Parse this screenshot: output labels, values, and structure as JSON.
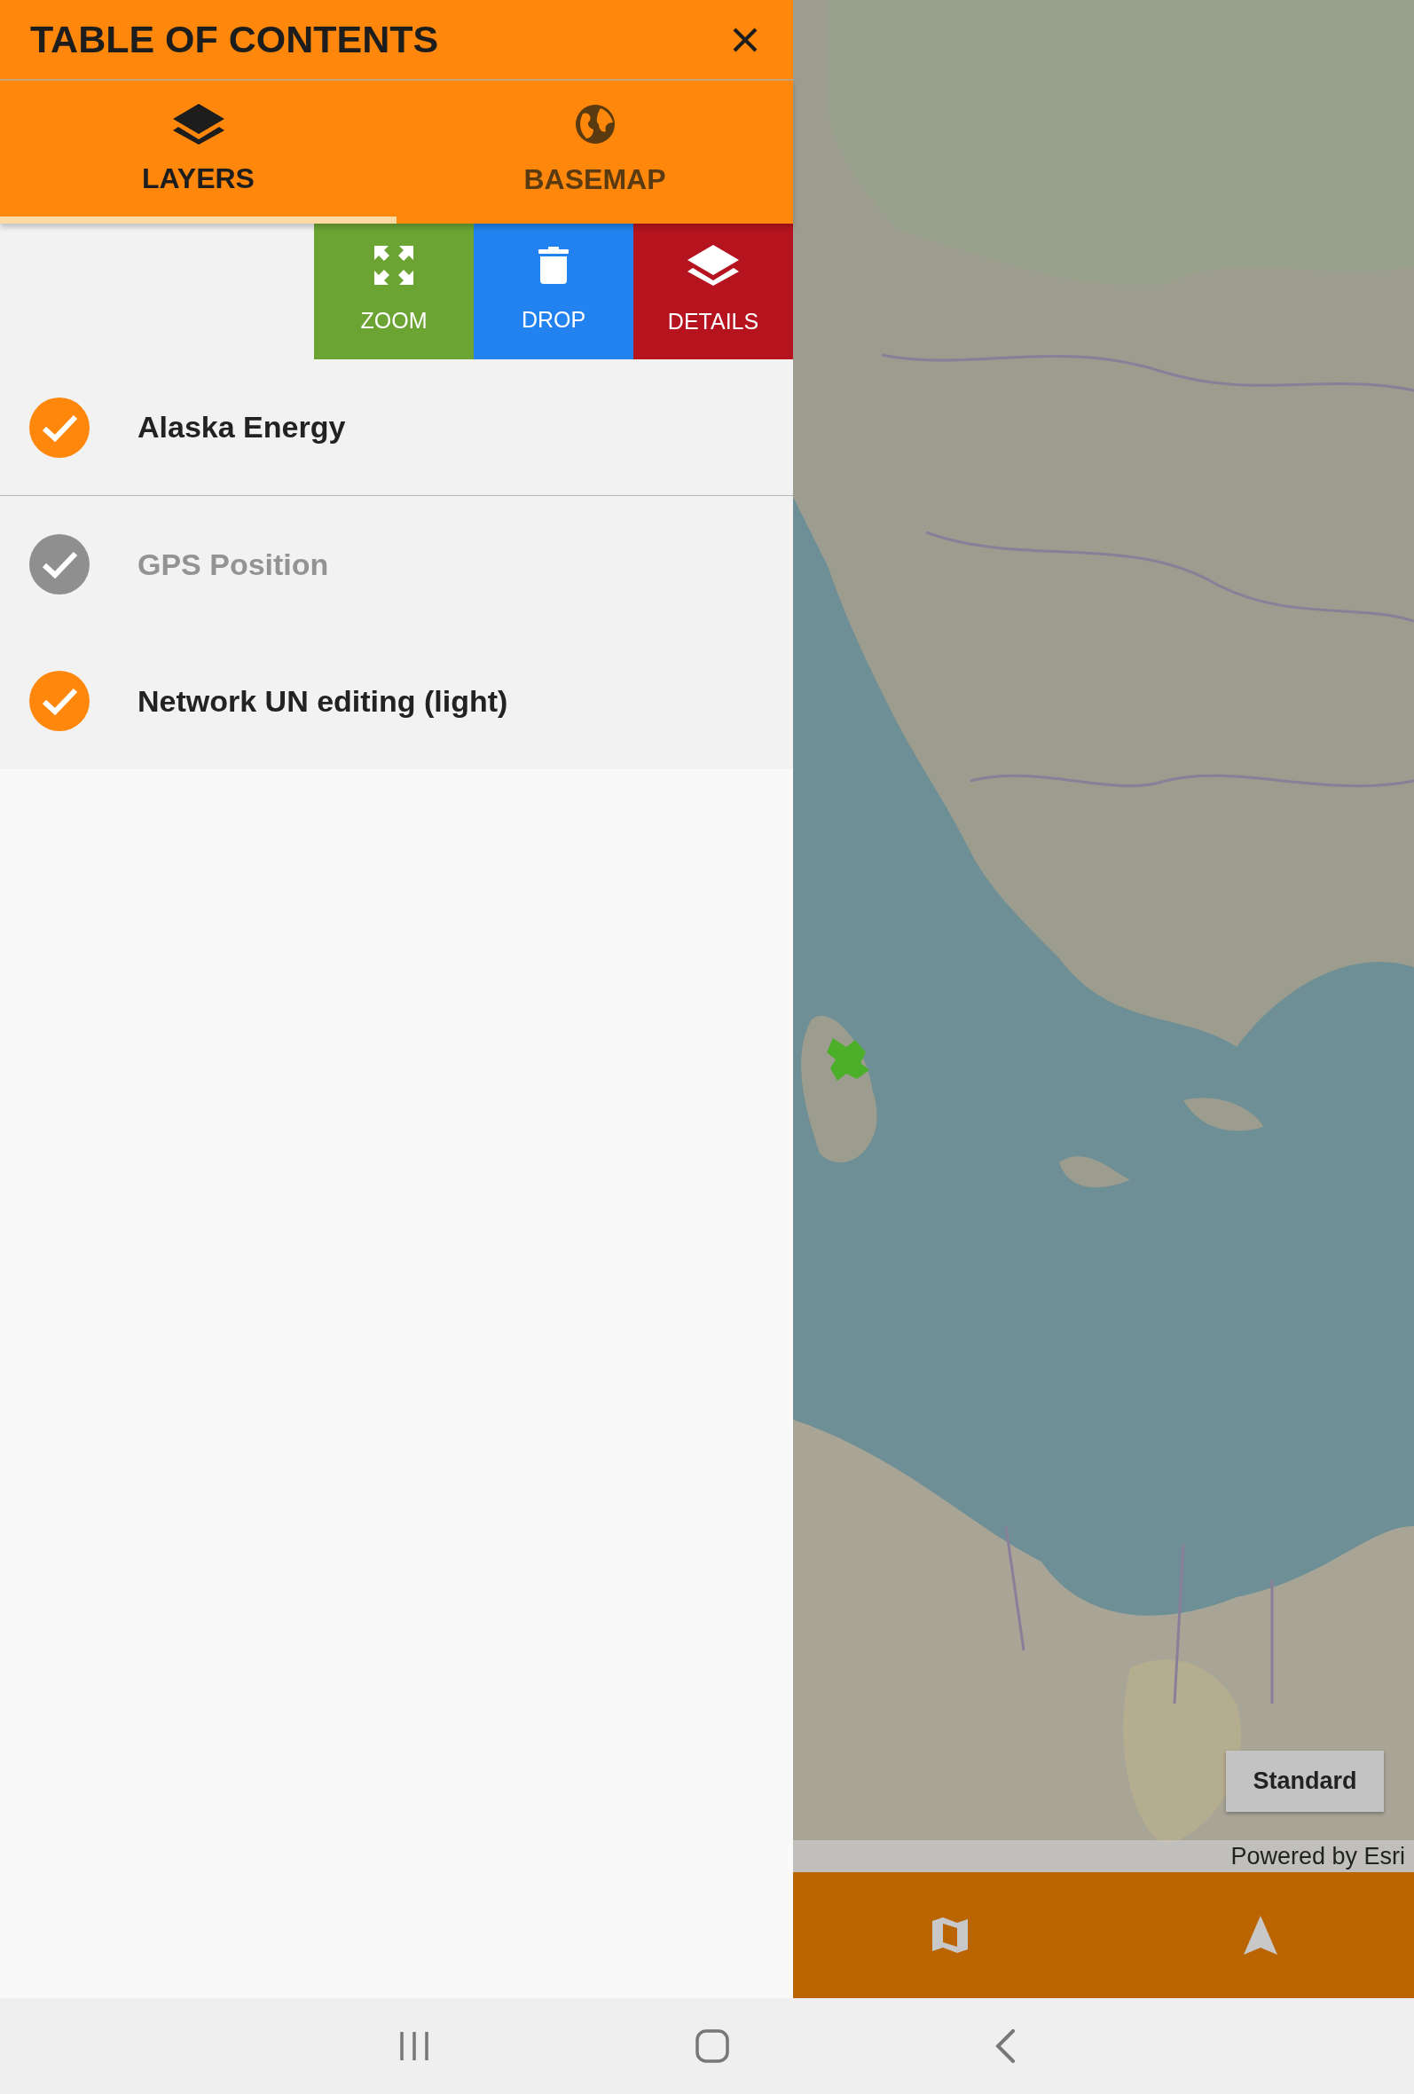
{
  "header": {
    "title": "TABLE OF CONTENTS"
  },
  "tabs": [
    {
      "label": "LAYERS",
      "kind": "layers",
      "selected": true
    },
    {
      "label": "BASEMAP",
      "kind": "basemap",
      "selected": false
    }
  ],
  "actions": [
    {
      "label": "ZOOM",
      "kind": "zoom"
    },
    {
      "label": "DROP",
      "kind": "drop"
    },
    {
      "label": "DETAILS",
      "kind": "details"
    }
  ],
  "layers": [
    {
      "name": "Alaska Energy",
      "visible": true
    },
    {
      "name": "GPS Position",
      "visible": false
    },
    {
      "name": "Network UN editing (light)",
      "visible": true
    }
  ],
  "map": {
    "basemap_button": "Standard",
    "attribution": "Powered by Esri"
  }
}
